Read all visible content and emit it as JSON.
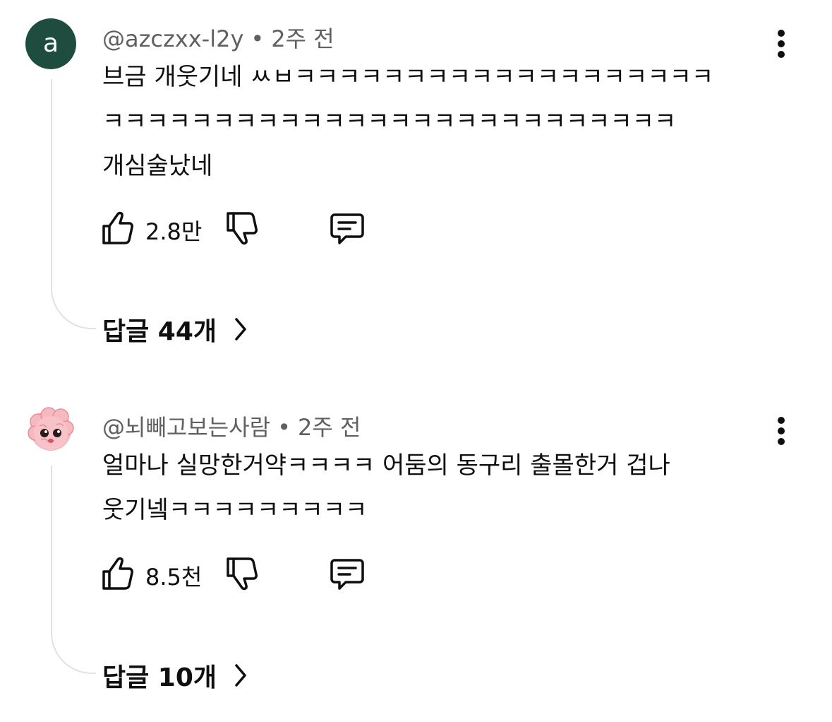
{
  "comments": [
    {
      "avatar_letter": "a",
      "avatar_color": "#1e4d3f",
      "username": "@azczxx-l2y",
      "separator": "•",
      "time": "2주 전",
      "text": "브금 개웃기네 ㅆㅂㅋㅋㅋㅋㅋㅋㅋㅋㅋㅋㅋㅋㅋㅋㅋㅋㅋㅋㅋ\nㅋㅋㅋㅋㅋㅋㅋㅋㅋㅋㅋㅋㅋㅋㅋㅋㅋㅋㅋㅋㅋㅋㅋㅋㅋㅋ\n개심술났네",
      "likes": "2.8만",
      "replies_label": "답글 44개",
      "icons": {
        "more": "more-vert-icon",
        "like": "thumb-up-icon",
        "dislike": "thumb-down-icon",
        "reply": "comment-icon",
        "chevron": "chevron-right-icon"
      }
    },
    {
      "avatar_image": "pink-brain-character",
      "username": "@뇌빼고보는사람",
      "separator": "•",
      "time": "2주 전",
      "text": "얼마나 실망한거약ㅋㅋㅋㅋ 어둠의 동구리 출몰한거 겁나\n웃기넼ㅋㅋㅋㅋㅋㅋㅋㅋㅋ",
      "likes": "8.5천",
      "replies_label": "답글 10개",
      "icons": {
        "more": "more-vert-icon",
        "like": "thumb-up-icon",
        "dislike": "thumb-down-icon",
        "reply": "comment-icon",
        "chevron": "chevron-right-icon"
      }
    }
  ]
}
